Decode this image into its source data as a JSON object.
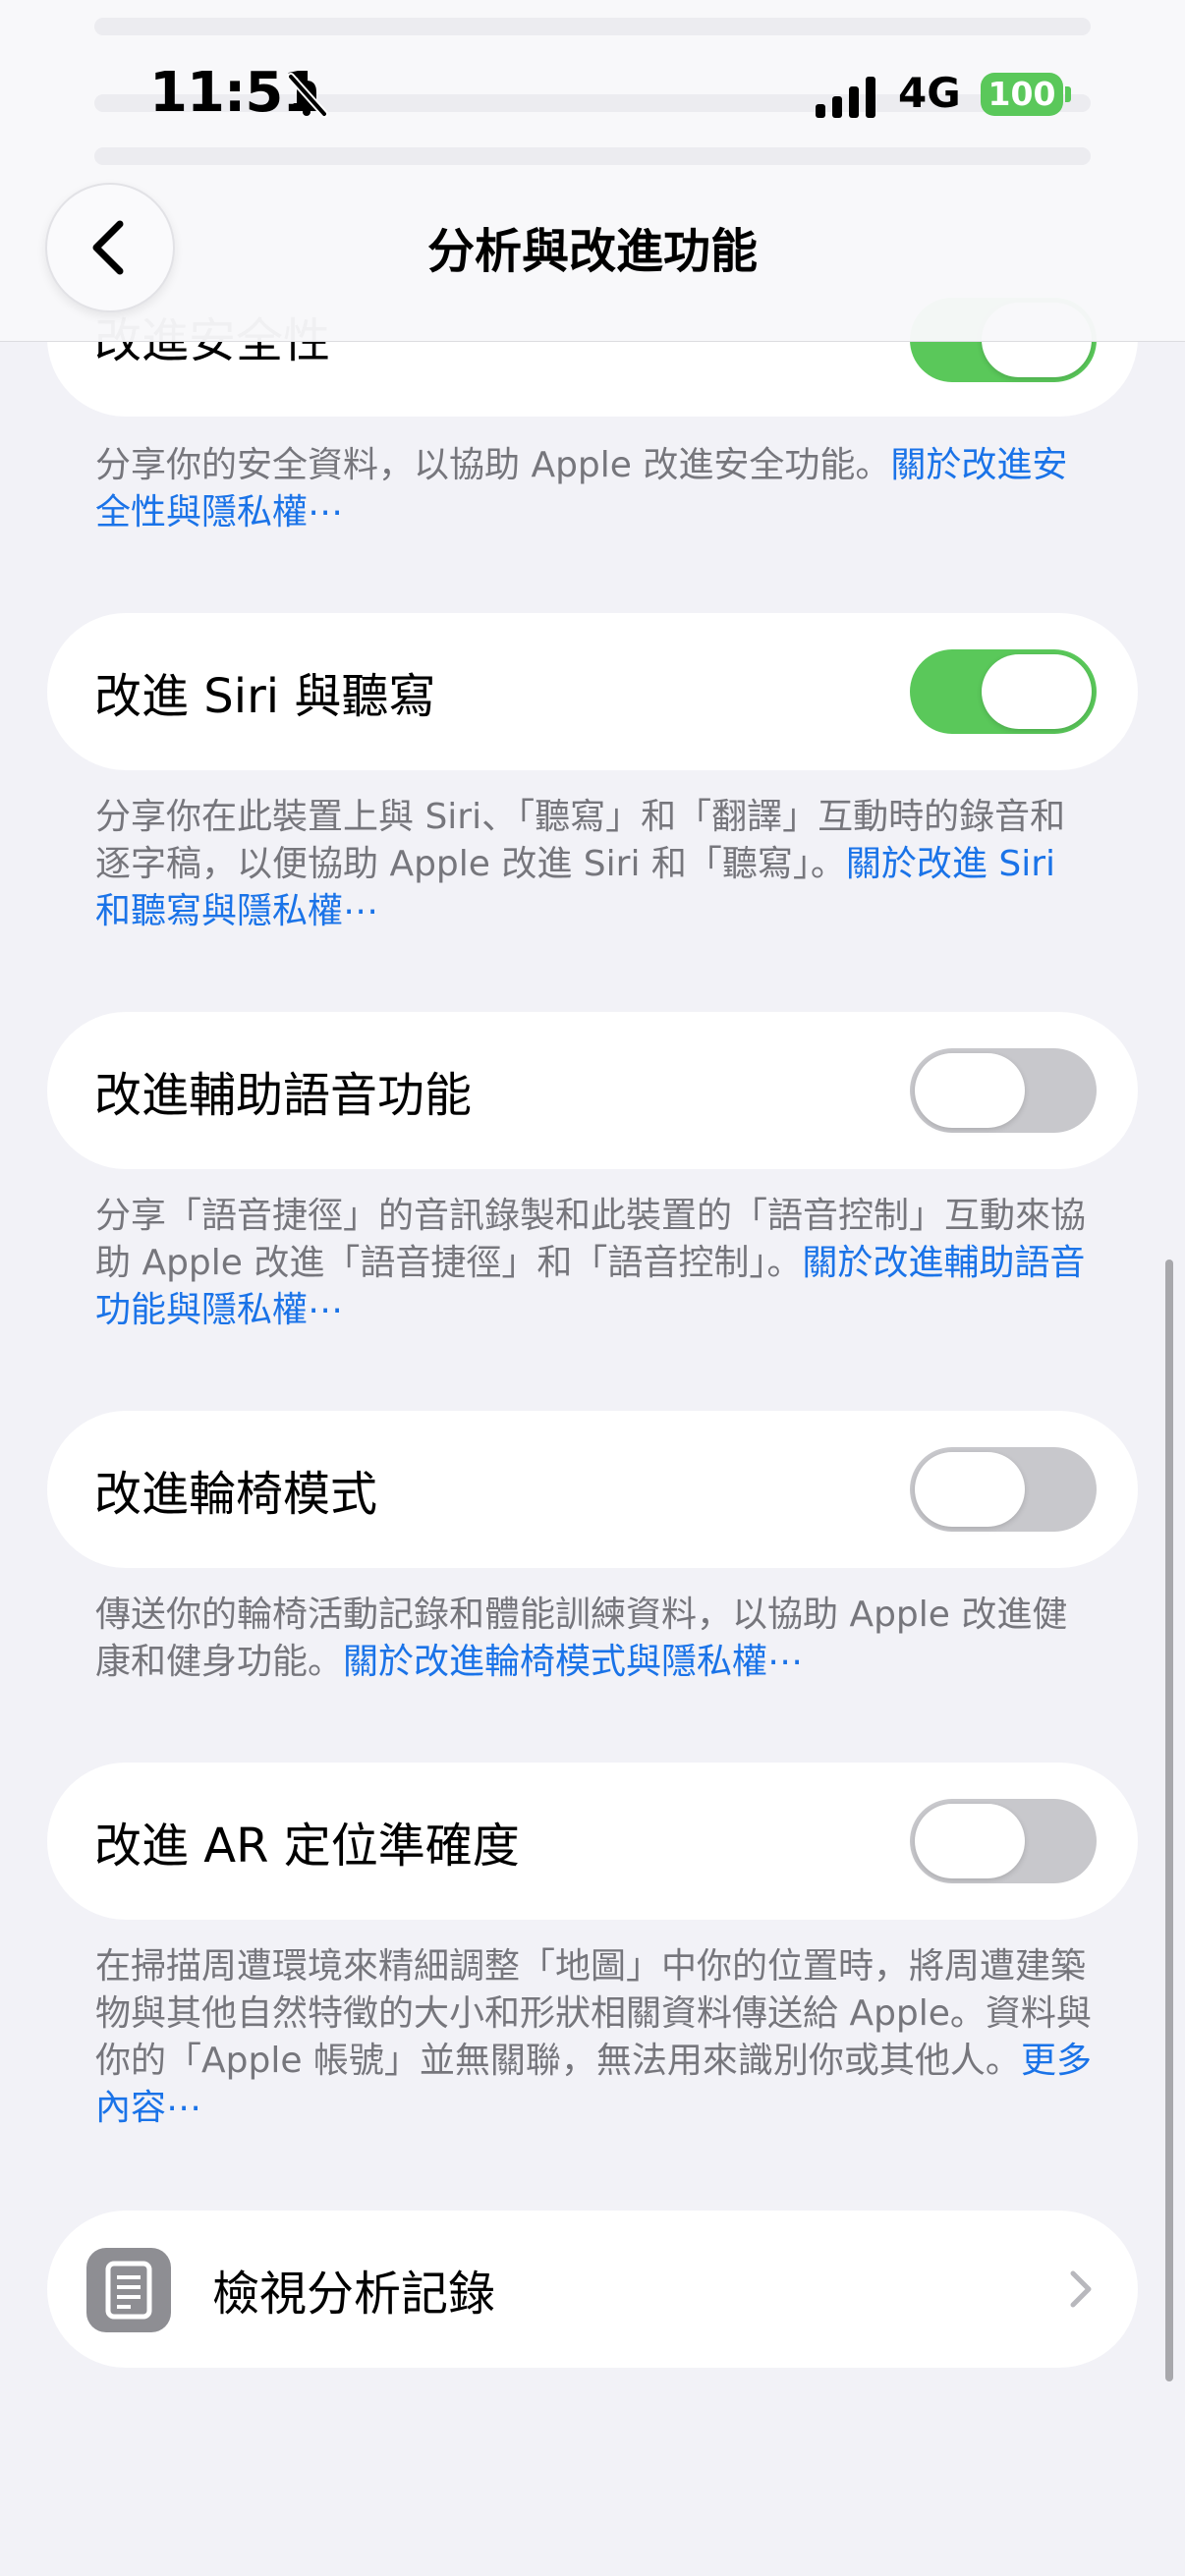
{
  "status_bar": {
    "time": "11:51",
    "network": "4G",
    "battery": "100"
  },
  "nav": {
    "title": "分析與改進功能"
  },
  "sections": [
    {
      "label": "改進安全性",
      "toggle_on": true,
      "footer_text": "分享你的安全資料，以協助 Apple 改進安全功能。",
      "footer_link": "關於改進安全性與隱私權⋯"
    },
    {
      "label": "改進 Siri 與聽寫",
      "toggle_on": true,
      "footer_text": "分享你在此裝置上與 Siri、「聽寫」和「翻譯」互動時的錄音和逐字稿，以便協助 Apple 改進 Siri 和「聽寫」。",
      "footer_link": "關於改進 Siri 和聽寫與隱私權⋯"
    },
    {
      "label": "改進輔助語音功能",
      "toggle_on": false,
      "footer_text": "分享「語音捷徑」的音訊錄製和此裝置的「語音控制」互動來協助 Apple 改進「語音捷徑」和「語音控制」。",
      "footer_link": "關於改進輔助語音功能與隱私權⋯"
    },
    {
      "label": "改進輪椅模式",
      "toggle_on": false,
      "footer_text": "傳送你的輪椅活動記錄和體能訓練資料，以協助 Apple 改進健康和健身功能。",
      "footer_link": "關於改進輪椅模式與隱私權⋯"
    },
    {
      "label": "改進 AR 定位準確度",
      "toggle_on": false,
      "footer_text": "在掃描周遭環境來精細調整「地圖」中你的位置時，將周遭建築物與其他自然特徵的大小和形狀相關資料傳送給 Apple。資料與你的「Apple 帳號」並無關聯，無法用來識別你或其他人。",
      "footer_link": "更多內容⋯"
    }
  ],
  "analytics_data": {
    "label": "檢視分析記錄",
    "icon": "document-list-icon"
  },
  "colors": {
    "toggle_on": "#5ac85a",
    "toggle_off": "#c8c8cc",
    "link": "#1a73e8",
    "background": "#f2f2f7"
  }
}
